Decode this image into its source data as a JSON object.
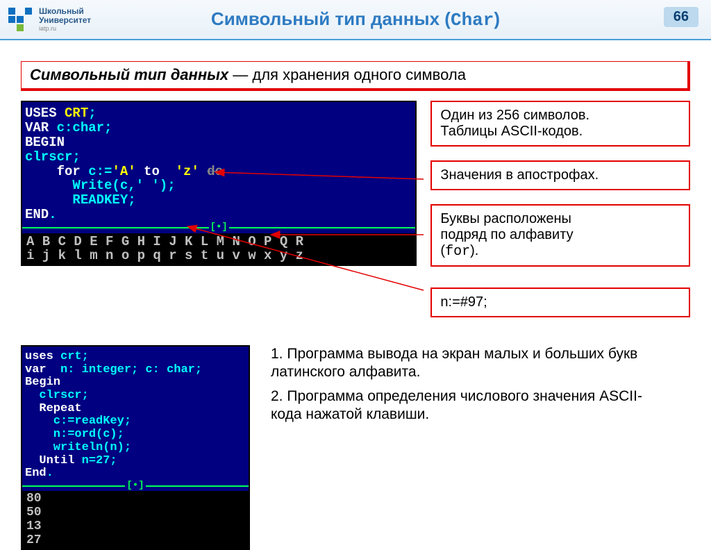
{
  "header": {
    "logo_line1": "Школьный",
    "logo_line2": "Университет",
    "logo_sub": "iatp.ru",
    "title_prefix": "Символьный тип данных  (",
    "title_mono": "Char",
    "title_suffix": ")",
    "page_number": "66"
  },
  "definition": {
    "term": "Символьный тип данных",
    "dash": " — ",
    "text": "для хранения одного символа"
  },
  "code1": {
    "l1_a": "USES ",
    "l1_b": "CRT",
    "l1_c": ";",
    "l2_a": "VAR ",
    "l2_b": "c:char;",
    "l3": "BEGIN",
    "l4": "clrscr;",
    "l5_a": "    for ",
    "l5_b": "c:=",
    "l5_c": "'A' ",
    "l5_d": "to  ",
    "l5_e": "'z' ",
    "l5_f": "do",
    "l6": "      Write(c,' ');",
    "l7": "      READKEY;",
    "l8_a": "END",
    "l8_b": ".",
    "sep": "[•]",
    "out1": "A B C D E F G H I J K L M N O P Q R",
    "out2": "i j k l m n o p q r s t u v w x y z"
  },
  "notes": {
    "n1a": "Один из 256 символов.",
    "n1b": "Таблицы ASCII-кодов.",
    "n2": "Значения в апострофах.",
    "n3a": "Буквы расположены",
    "n3b": "подряд по алфавиту",
    "n3c": "(",
    "n3mono": "for",
    "n3d": ").",
    "n4": "n:=#97;"
  },
  "code2": {
    "l1_a": "uses ",
    "l1_b": "crt;",
    "l2_a": "var  ",
    "l2_b": "n: integer; c: char;",
    "l3": "Begin",
    "l4": "  clrscr;",
    "l5": "  Repeat",
    "l6": "    c:=readKey;",
    "l7": "    n:=ord(c);",
    "l8": "    writeln(n);",
    "l9_a": "  Until ",
    "l9_b": "n=27;",
    "l10_a": "End",
    "l10_b": ".",
    "sep": "[•]",
    "out": [
      "80",
      "50",
      "13",
      "27"
    ]
  },
  "tasks": {
    "t1": "1. Программа вывода на экран малых и больших букв латинского алфавита.",
    "t2": "2. Программа определения числового значения ASCII-кода нажатой клавиши."
  }
}
